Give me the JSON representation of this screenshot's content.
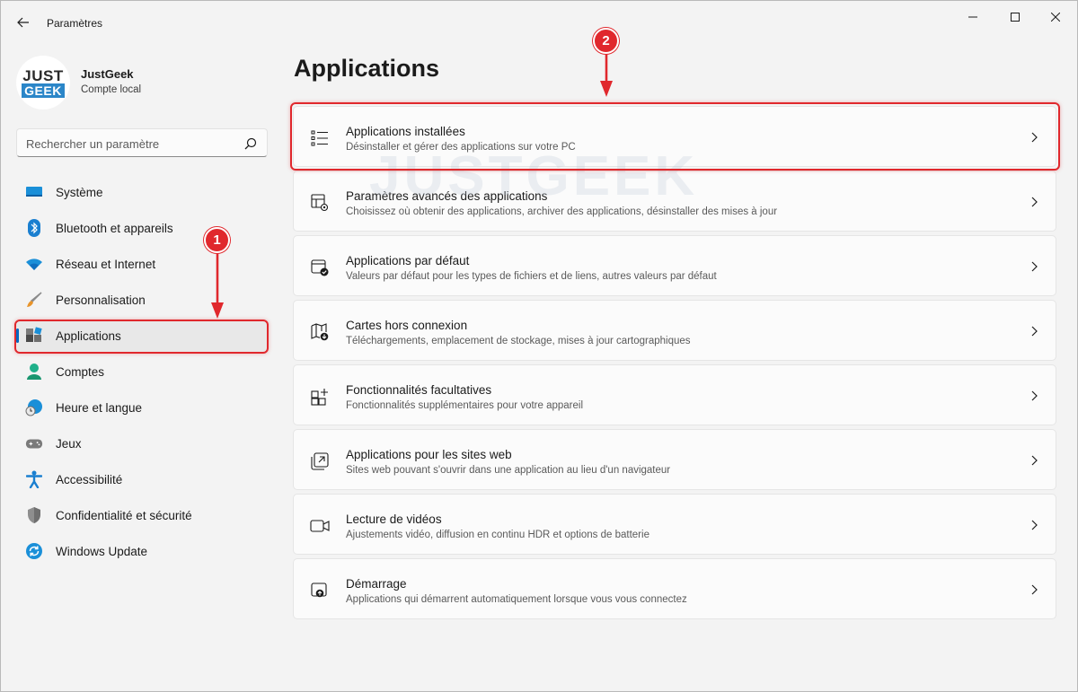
{
  "window": {
    "title": "Paramètres"
  },
  "profile": {
    "name": "JustGeek",
    "subtitle": "Compte local",
    "logo_top": "JUST",
    "logo_bottom": "GEEK"
  },
  "search": {
    "placeholder": "Rechercher un paramètre"
  },
  "sidebar": {
    "items": [
      {
        "label": "Système",
        "icon": "monitor-icon"
      },
      {
        "label": "Bluetooth et appareils",
        "icon": "bluetooth-icon"
      },
      {
        "label": "Réseau et Internet",
        "icon": "wifi-icon"
      },
      {
        "label": "Personnalisation",
        "icon": "brush-icon"
      },
      {
        "label": "Applications",
        "icon": "apps-icon",
        "selected": true
      },
      {
        "label": "Comptes",
        "icon": "person-icon"
      },
      {
        "label": "Heure et langue",
        "icon": "globe-clock-icon"
      },
      {
        "label": "Jeux",
        "icon": "gamepad-icon"
      },
      {
        "label": "Accessibilité",
        "icon": "accessibility-icon"
      },
      {
        "label": "Confidentialité et sécurité",
        "icon": "shield-icon"
      },
      {
        "label": "Windows Update",
        "icon": "refresh-icon"
      }
    ]
  },
  "main": {
    "title": "Applications",
    "cards": [
      {
        "title": "Applications installées",
        "desc": "Désinstaller et gérer des applications sur votre PC",
        "icon": "list-icon"
      },
      {
        "title": "Paramètres avancés des applications",
        "desc": "Choisissez où obtenir des applications, archiver des applications, désinstaller des mises à jour",
        "icon": "app-settings-icon"
      },
      {
        "title": "Applications par défaut",
        "desc": "Valeurs par défaut pour les types de fichiers et de liens, autres valeurs par défaut",
        "icon": "default-apps-icon"
      },
      {
        "title": "Cartes hors connexion",
        "desc": "Téléchargements, emplacement de stockage, mises à jour cartographiques",
        "icon": "offline-map-icon"
      },
      {
        "title": "Fonctionnalités facultatives",
        "desc": "Fonctionnalités supplémentaires pour votre appareil",
        "icon": "add-features-icon"
      },
      {
        "title": "Applications pour les sites web",
        "desc": "Sites web pouvant s'ouvrir dans une application au lieu d'un navigateur",
        "icon": "open-in-app-icon"
      },
      {
        "title": "Lecture de vidéos",
        "desc": "Ajustements vidéo, diffusion en continu HDR et options de batterie",
        "icon": "video-icon"
      },
      {
        "title": "Démarrage",
        "desc": "Applications qui démarrent automatiquement lorsque vous vous connectez",
        "icon": "startup-icon"
      }
    ]
  },
  "watermark": "JUSTGEEK",
  "annotations": {
    "step1": "1",
    "step2": "2",
    "color": "#e0282d"
  },
  "colors": {
    "accent": "#0067c0",
    "background": "#f3f3f3",
    "card": "#fbfbfb"
  }
}
